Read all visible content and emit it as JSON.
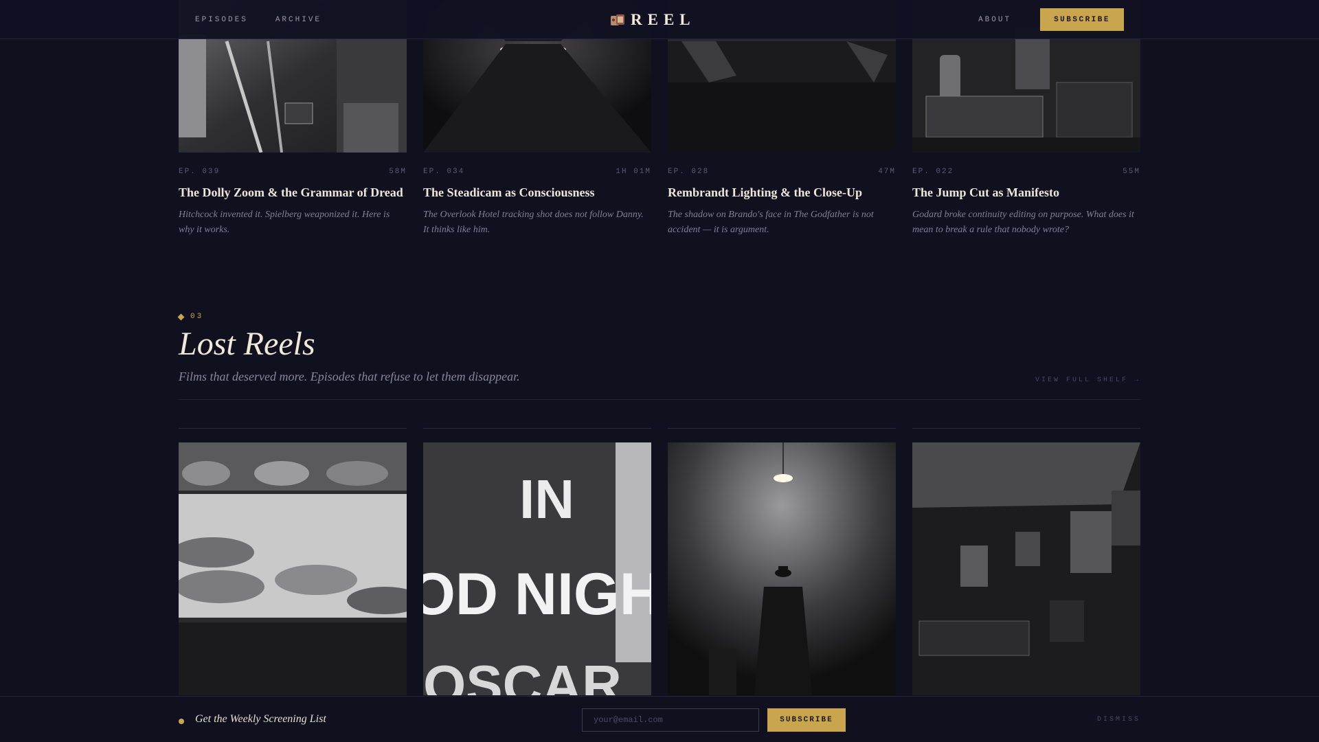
{
  "nav": {
    "left_links": [
      "EPISODES",
      "ARCHIVE"
    ],
    "brand": "REEL",
    "about": "ABOUT",
    "subscribe": "SUBSCRIBE"
  },
  "episodes": [
    {
      "ep": "EP. 039",
      "duration": "58M",
      "title": "The Dolly Zoom & the Grammar of Dread",
      "desc": "Hitchcock invented it. Spielberg weaponized it. Here is why it works."
    },
    {
      "ep": "EP. 034",
      "duration": "1H 01M",
      "title": "The Steadicam as Consciousness",
      "desc": "The Overlook Hotel tracking shot does not follow Danny. It thinks like him."
    },
    {
      "ep": "EP. 028",
      "duration": "47M",
      "title": "Rembrandt Lighting & the Close-Up",
      "desc": "The shadow on Brando's face in The Godfather is not accident — it is argument."
    },
    {
      "ep": "EP. 022",
      "duration": "55M",
      "title": "The Jump Cut as Manifesto",
      "desc": "Godard broke continuity editing on purpose. What does it mean to break a rule that nobody wrote?"
    }
  ],
  "section": {
    "number": "03",
    "title": "Lost Reels",
    "subtitle": "Films that deserved more. Episodes that refuse to let them disappear.",
    "view_link": "VIEW FULL SHELF →"
  },
  "newsletter": {
    "text": "Get the Weekly Screening List",
    "placeholder": "your@email.com",
    "button": "SUBSCRIBE",
    "dismiss": "DISMISS"
  },
  "colors": {
    "accent": "#c9a64e",
    "background": "#11101f",
    "text": "#ece7da"
  }
}
